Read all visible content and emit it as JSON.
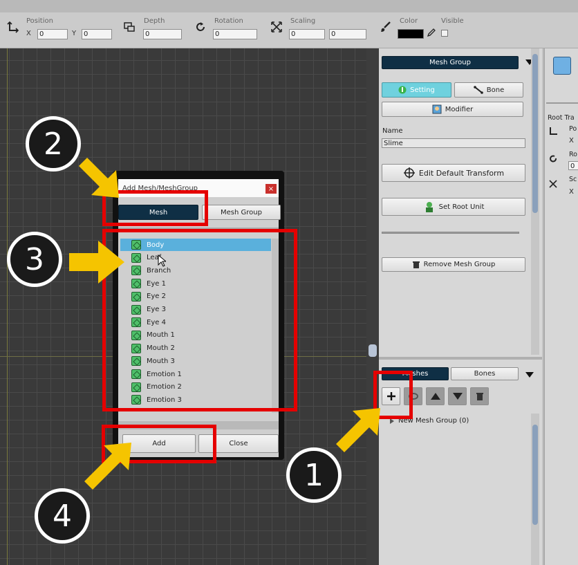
{
  "toolbar": {
    "position_label": "Position",
    "x_label": "X",
    "x_value": "0",
    "y_label": "Y",
    "y_value": "0",
    "depth_label": "Depth",
    "depth_value": "0",
    "rotation_label": "Rotation",
    "rotation_value": "0",
    "scaling_label": "Scaling",
    "scaling_x": "0",
    "scaling_y": "0",
    "color_label": "Color",
    "visible_label": "Visible"
  },
  "inspector": {
    "header": "Mesh Group",
    "setting_tab": "Setting",
    "bone_tab": "Bone",
    "modifier_button": "Modifier",
    "name_label": "Name",
    "name_value": "Slime",
    "edit_default_transform": "Edit Default Transform",
    "set_root_unit": "Set Root Unit",
    "remove_mesh_group": "Remove Mesh Group"
  },
  "hierarchy": {
    "meshes_tab": "Meshes",
    "bones_tab": "Bones",
    "tree_item": "New Mesh Group (0)"
  },
  "far_panel": {
    "root_label": "Root Tra",
    "pos_label": "Po",
    "x1": "X",
    "rot_label": "Ro",
    "rot_value": "0",
    "scale_label": "Sc",
    "x2": "X"
  },
  "dialog": {
    "title": "Add Mesh/MeshGroup",
    "close_x": "×",
    "tab_mesh": "Mesh",
    "tab_mesh_group": "Mesh Group",
    "items": [
      "Body",
      "Leaf",
      "Branch",
      "Eye 1",
      "Eye 2",
      "Eye 3",
      "Eye 4",
      "Mouth 1",
      "Mouth 2",
      "Mouth 3",
      "Emotion 1",
      "Emotion 2",
      "Emotion 3"
    ],
    "add_button": "Add",
    "close_button": "Close"
  },
  "callouts": {
    "one": "1",
    "two": "2",
    "three": "3",
    "four": "4",
    "accent_red": "#e50000",
    "accent_yellow": "#f5c400"
  }
}
